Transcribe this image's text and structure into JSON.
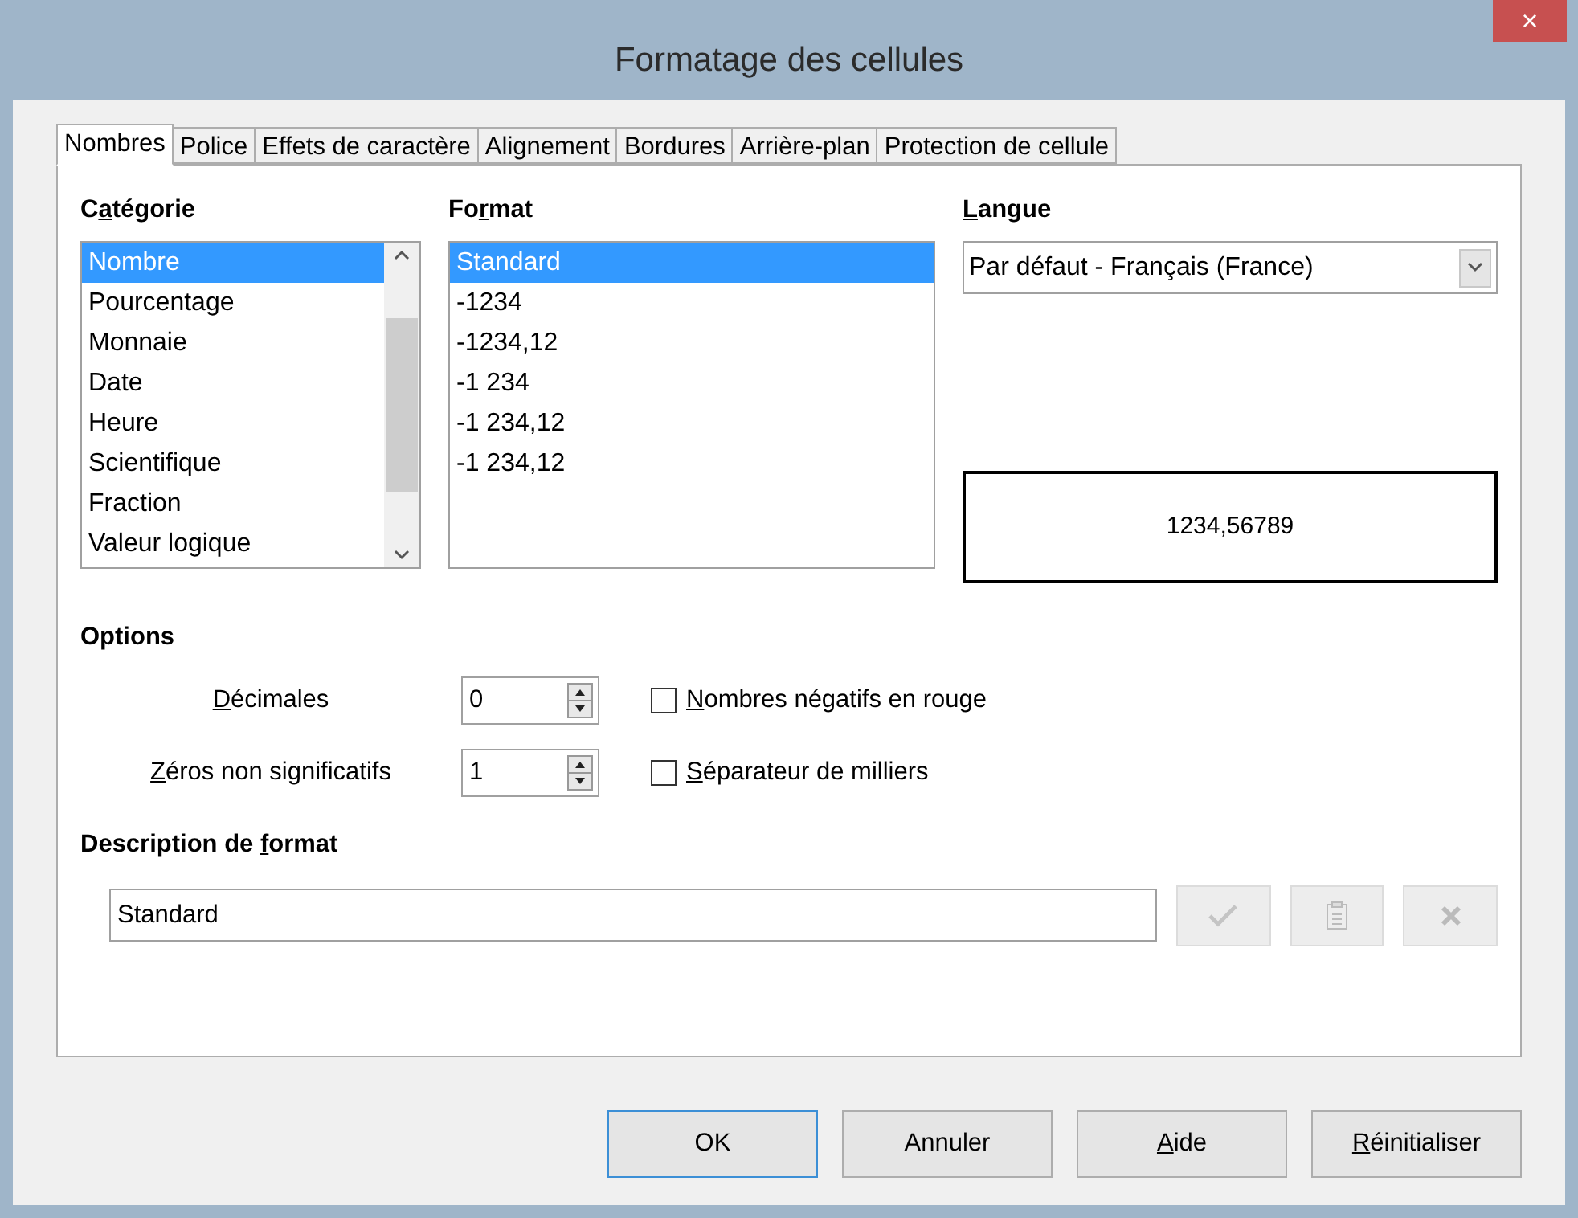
{
  "window": {
    "title": "Formatage des cellules",
    "close": "×"
  },
  "tabs": [
    {
      "label": "Nombres",
      "selected": true
    },
    {
      "label": "Police",
      "selected": false
    },
    {
      "label": "Effets de caractère",
      "selected": false
    },
    {
      "label": "Alignement",
      "selected": false
    },
    {
      "label": "Bordures",
      "selected": false
    },
    {
      "label": "Arrière-plan",
      "selected": false
    },
    {
      "label": "Protection de cellule",
      "selected": false
    }
  ],
  "category": {
    "label": {
      "before": "C",
      "key": "a",
      "after": "tégorie"
    },
    "items": [
      {
        "label": "Nombre",
        "selected": true
      },
      {
        "label": "Pourcentage",
        "selected": false
      },
      {
        "label": "Monnaie",
        "selected": false
      },
      {
        "label": "Date",
        "selected": false
      },
      {
        "label": "Heure",
        "selected": false
      },
      {
        "label": "Scientifique",
        "selected": false
      },
      {
        "label": "Fraction",
        "selected": false
      },
      {
        "label": "Valeur logique",
        "selected": false
      }
    ]
  },
  "format": {
    "label": {
      "before": "Fo",
      "key": "r",
      "after": "mat"
    },
    "items": [
      {
        "label": "Standard",
        "selected": true
      },
      {
        "label": "-1234",
        "selected": false
      },
      {
        "label": "-1234,12",
        "selected": false
      },
      {
        "label": "-1 234",
        "selected": false
      },
      {
        "label": "-1 234,12",
        "selected": false
      },
      {
        "label": "-1 234,12",
        "selected": false
      }
    ]
  },
  "language": {
    "label": {
      "key": "L",
      "after": "angue"
    },
    "value": "Par défaut - Français (France)"
  },
  "preview": "1234,56789",
  "options": {
    "label": "Options",
    "spinners": [
      {
        "label": {
          "key": "D",
          "after": "écimales"
        },
        "value": "0"
      },
      {
        "label": {
          "key": "Z",
          "after": "éros non significatifs"
        },
        "value": "1"
      }
    ],
    "checkboxes": [
      {
        "label": {
          "key": "N",
          "after": "ombres négatifs en rouge"
        },
        "checked": false
      },
      {
        "label": {
          "key": "S",
          "after": "éparateur de milliers"
        },
        "checked": false
      }
    ]
  },
  "format_code": {
    "label": {
      "before": "Description de ",
      "key": "f",
      "after": "ormat"
    },
    "value": "Standard"
  },
  "buttons": [
    {
      "label": {
        "before": "OK"
      },
      "default": true
    },
    {
      "label": {
        "before": "Annuler"
      },
      "default": false
    },
    {
      "label": {
        "key": "A",
        "after": "ide"
      },
      "default": false
    },
    {
      "label": {
        "key": "R",
        "after": "éinitialiser"
      },
      "default": false
    }
  ]
}
